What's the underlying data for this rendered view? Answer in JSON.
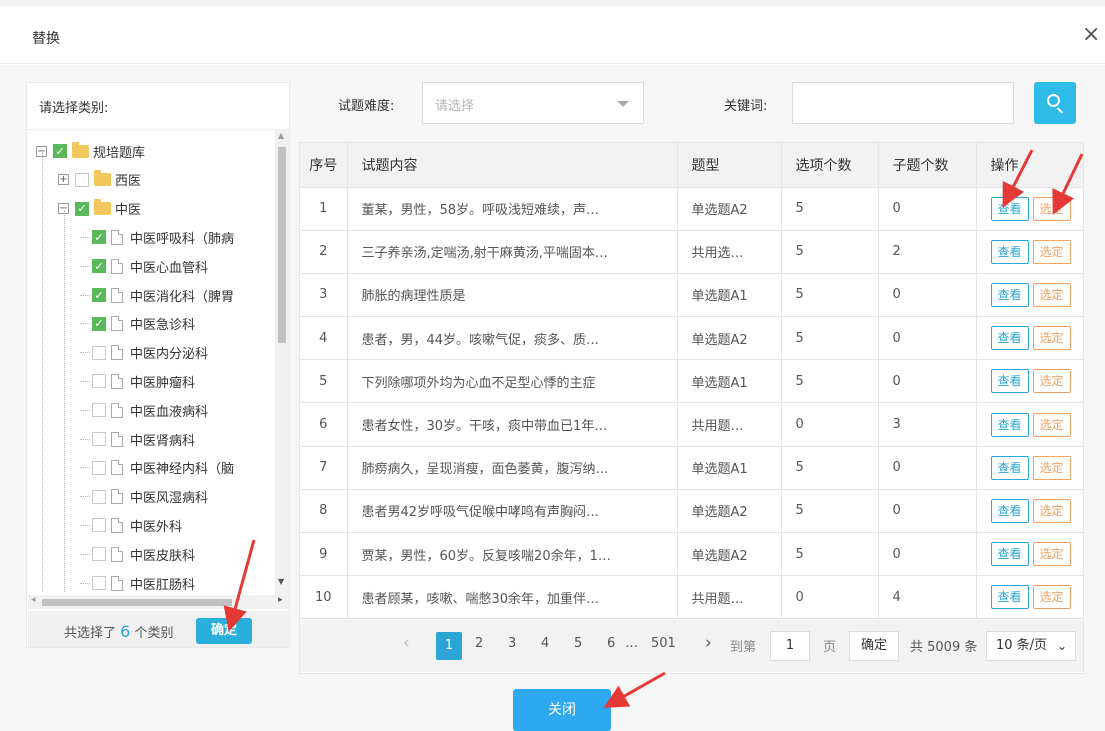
{
  "dialog": {
    "title": "替换",
    "close_glyph": "×"
  },
  "left": {
    "label": "请选择类别:",
    "tree": [
      {
        "label": "规培题库",
        "checked": true,
        "kind": "folder",
        "expander": "−"
      },
      {
        "label": "西医",
        "checked": false,
        "kind": "folder",
        "expander": "+"
      },
      {
        "label": "中医",
        "checked": true,
        "kind": "folder",
        "expander": "−"
      },
      {
        "label": "中医呼吸科（肺病",
        "checked": true,
        "kind": "file"
      },
      {
        "label": "中医心血管科",
        "checked": true,
        "kind": "file"
      },
      {
        "label": "中医消化科（脾胃",
        "checked": true,
        "kind": "file"
      },
      {
        "label": "中医急诊科",
        "checked": true,
        "kind": "file"
      },
      {
        "label": "中医内分泌科",
        "checked": false,
        "kind": "file"
      },
      {
        "label": "中医肿瘤科",
        "checked": false,
        "kind": "file"
      },
      {
        "label": "中医血液病科",
        "checked": false,
        "kind": "file"
      },
      {
        "label": "中医肾病科",
        "checked": false,
        "kind": "file"
      },
      {
        "label": "中医神经内科（脑",
        "checked": false,
        "kind": "file"
      },
      {
        "label": "中医风湿病科",
        "checked": false,
        "kind": "file"
      },
      {
        "label": "中医外科",
        "checked": false,
        "kind": "file"
      },
      {
        "label": "中医皮肤科",
        "checked": false,
        "kind": "file"
      },
      {
        "label": "中医肛肠科",
        "checked": false,
        "kind": "file"
      }
    ],
    "footer": {
      "prefix": "共选择了",
      "count": "6",
      "suffix": "个类别",
      "confirm_label": "确定"
    }
  },
  "filters": {
    "difficulty_label": "试题难度:",
    "difficulty_placeholder": "请选择",
    "keyword_label": "关键词:",
    "keyword_value": ""
  },
  "table": {
    "headers": [
      "序号",
      "试题内容",
      "题型",
      "选项个数",
      "子题个数",
      "操作"
    ],
    "rows": [
      [
        "1",
        "董某，男性，58岁。呼吸浅短难续，声…",
        "单选题A2",
        "5",
        "0"
      ],
      [
        "2",
        "三子养亲汤,定喘汤,射干麻黄汤,平喘固本…",
        "共用选…",
        "5",
        "2"
      ],
      [
        "3",
        "肺胀的病理性质是",
        "单选题A1",
        "5",
        "0"
      ],
      [
        "4",
        "患者，男，44岁。咳嗽气促，痰多、质…",
        "单选题A2",
        "5",
        "0"
      ],
      [
        "5",
        "下列除哪项外均为心血不足型心悸的主症",
        "单选题A1",
        "5",
        "0"
      ],
      [
        "6",
        "患者女性，30岁。干咳，痰中带血已1年…",
        "共用题…",
        "0",
        "3"
      ],
      [
        "7",
        "肺痨病久，呈现消瘦，面色萎黄，腹泻纳…",
        "单选题A1",
        "5",
        "0"
      ],
      [
        "8",
        "患者男42岁呼吸气促喉中哮鸣有声胸闷…",
        "单选题A2",
        "5",
        "0"
      ],
      [
        "9",
        "贾某，男性，60岁。反复咳喘20余年，1…",
        "单选题A2",
        "5",
        "0"
      ],
      [
        "10",
        "患者顾某，咳嗽、喘憋30余年，加重伴…",
        "共用题…",
        "0",
        "4"
      ]
    ],
    "view_label": "查看",
    "pick_label": "选定"
  },
  "pager": {
    "prev": "‹",
    "pages": [
      "1",
      "2",
      "3",
      "4",
      "5",
      "6",
      "…",
      "501"
    ],
    "next": "›",
    "goto_prefix": "到第",
    "goto_value": "1",
    "goto_suffix": "页",
    "goto_btn": "确定",
    "total": "共 5009 条",
    "page_size": "10 条/页",
    "page_size_chevron": "⌄"
  },
  "footer": {
    "close_label": "关闭"
  },
  "colors": {
    "accent": "#2aa5d6",
    "check": "#5cb85c",
    "pick": "#f0a060",
    "annotation_arrow": "#e53935"
  }
}
